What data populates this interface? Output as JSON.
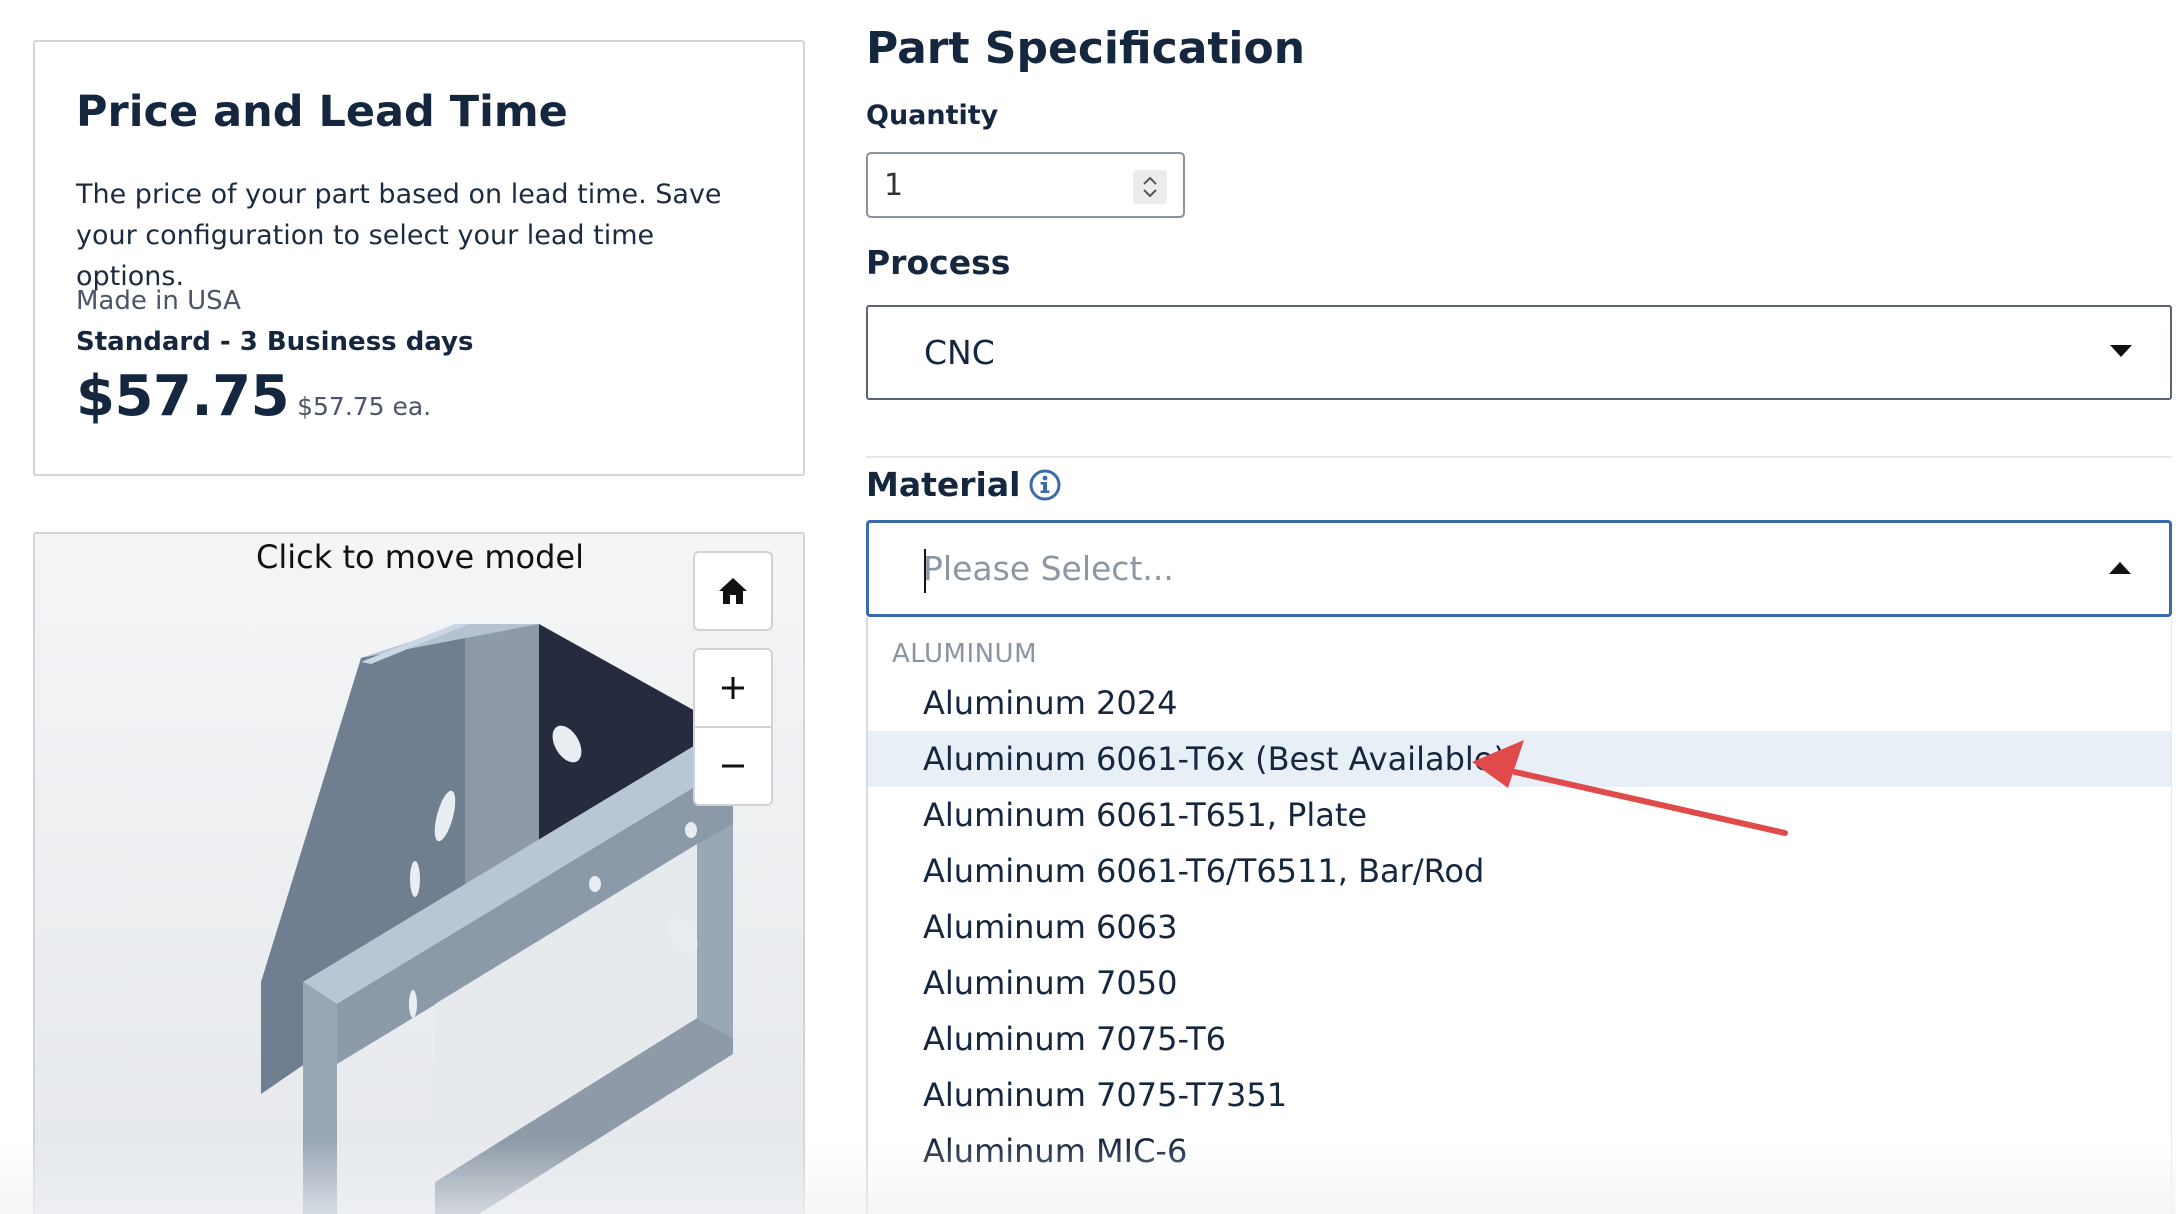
{
  "price_card": {
    "title": "Price and Lead Time",
    "description": "The price of your part based on lead time. Save your configuration to select your lead time options.",
    "origin": "Made in USA",
    "lead_time": "Standard - 3 Business days",
    "price": "$57.75",
    "unit_price": "$57.75 ea."
  },
  "viewer": {
    "hint": "Click to move model",
    "home_icon": "home-icon",
    "zoom_in_icon": "plus-icon",
    "zoom_out_icon": "minus-icon"
  },
  "spec": {
    "title": "Part Specification",
    "quantity_label": "Quantity",
    "quantity_value": "1",
    "process_label": "Process",
    "process_value": "CNC",
    "material_label": "Material",
    "material_placeholder": "Please Select...",
    "material_group": "ALUMINUM",
    "material_options": [
      "Aluminum 2024",
      "Aluminum 6061-T6x (Best Available)",
      "Aluminum 6061-T651, Plate",
      "Aluminum 6061-T6/T6511, Bar/Rod",
      "Aluminum 6063",
      "Aluminum 7050",
      "Aluminum 7075-T6",
      "Aluminum 7075-T7351",
      "Aluminum MIC-6"
    ],
    "highlighted_option": "Aluminum 6061-T6x (Best Available)"
  },
  "colors": {
    "accent": "#3d6aa8",
    "annotation_arrow": "#e04a4a",
    "highlight_row": "#e9eff7"
  }
}
